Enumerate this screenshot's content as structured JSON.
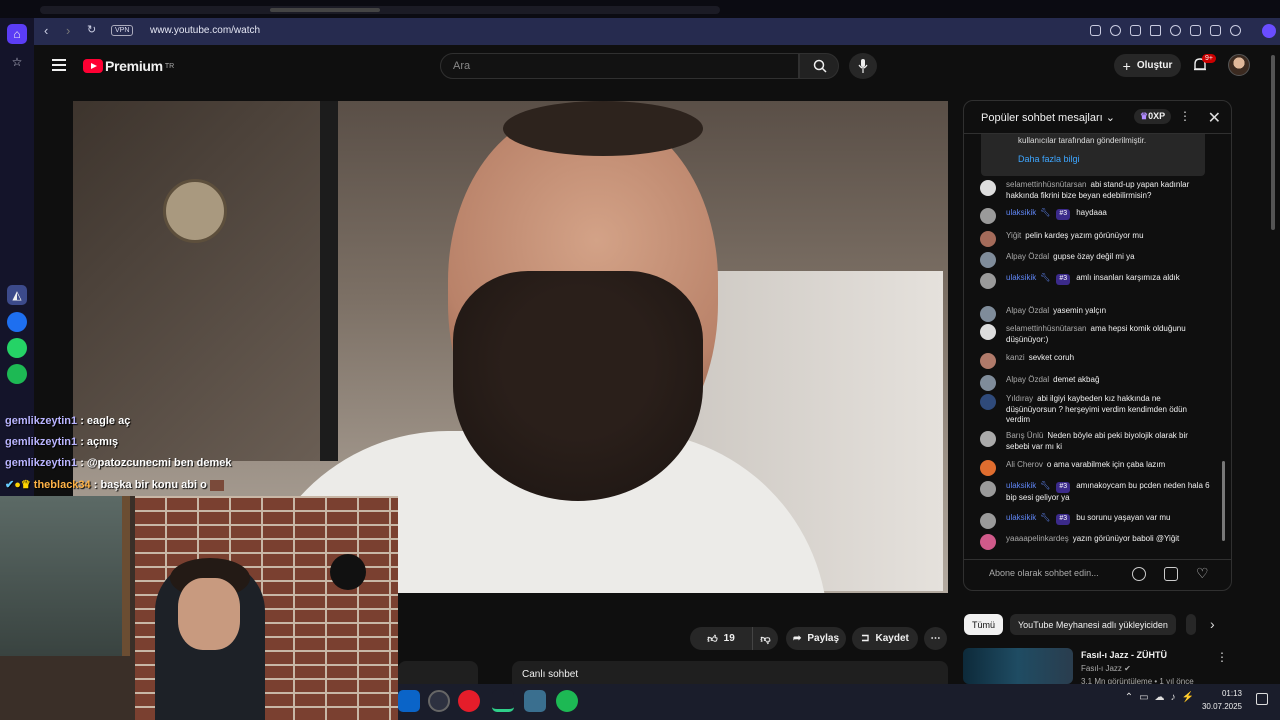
{
  "browser": {
    "vpn_label": "VPN",
    "url": "www.youtube.com/watch"
  },
  "header": {
    "logo_text": "Premium",
    "logo_region": "TR",
    "search_placeholder": "Ara",
    "create_label": "Oluştur",
    "notif_badge": "9+"
  },
  "video_actions": {
    "like_count": "19",
    "share_label": "Paylaş",
    "save_label": "Kaydet"
  },
  "below_video": {
    "live_chat_label": "Canlı sohbet"
  },
  "chat": {
    "title": "Popüler sohbet mesajları",
    "xp_label": "0XP",
    "notice_text": "kullanıcılar tarafından gönderilmiştir.",
    "notice_link": "Daha fazla bilgi",
    "messages": [
      {
        "author": "selamettinhüsnütarsan",
        "rank": "",
        "text": "abi stand-up yapan kadınlar hakkında fikrini bize beyan edebilirmisin?"
      },
      {
        "author": "ulaksikik",
        "rank": "#3",
        "text": "haydaaa"
      },
      {
        "author": "Yiğit",
        "rank": "",
        "text": "pelin kardeş yazım görünüyor mu"
      },
      {
        "author": "Alpay Özdal",
        "rank": "",
        "text": "gupse özay değil mi ya"
      },
      {
        "author": "ulaksikik",
        "rank": "#3",
        "text": "amlı insanları karşımıza aldık"
      },
      {
        "author": "Alpay Özdal",
        "rank": "",
        "text": "yasemin yalçın"
      },
      {
        "author": "selamettinhüsnütarsan",
        "rank": "",
        "text": "ama hepsi komik olduğunu düşünüyor:)"
      },
      {
        "author": "kanzi",
        "rank": "",
        "text": "sevket coruh"
      },
      {
        "author": "Alpay Özdal",
        "rank": "",
        "text": "demet akbağ"
      },
      {
        "author": "Yıldıray",
        "rank": "",
        "text": "abi ilgiyi kaybeden kız hakkında ne düşünüyorsun ? herşeyimi verdim kendimden ödün verdim"
      },
      {
        "author": "Barış Ünlü",
        "rank": "",
        "text": "Neden böyle abi peki biyolojik olarak bir sebebi var mı ki"
      },
      {
        "author": "Ali Cherov",
        "rank": "",
        "text": "o ama varabilmek için çaba lazım"
      },
      {
        "author": "ulaksikik",
        "rank": "#3",
        "text": "amınakoycam bu pcden neden hala 6 bip sesi geliyor ya"
      },
      {
        "author": "ulaksikik",
        "rank": "#3",
        "text": "bu sorunu yaşayan var mu"
      },
      {
        "author": "yaaaapelinkardeş",
        "rank": "",
        "text": "yazın görünüyor baboli @Yiğit"
      }
    ],
    "input_placeholder": "Abone olarak sohbet edin..."
  },
  "chips": [
    "Tümü",
    "YouTube Meyhanesi adlı yükleyiciden"
  ],
  "recommendation": {
    "title": "Fasıl-ı Jazz - ZÜHTÜ",
    "channel": "Fasıl-ı Jazz",
    "meta": "3,1 Mn görüntüleme • 1 yıl önce"
  },
  "overlay_chat": [
    {
      "user": "gemlikzeytin1",
      "text": ": eagle aç"
    },
    {
      "user": "gemlikzeytin1",
      "text": ": açmış"
    },
    {
      "user": "gemlikzeytin1",
      "text": ": @patozcunecmi ben demek"
    },
    {
      "user": "theblack34",
      "text": ": başka bir konu abi o"
    }
  ],
  "taskbar": {
    "time": "01:13",
    "date": "30.07.2025"
  },
  "colors": {
    "accent_red": "#ff0033",
    "link_blue": "#3ea6ff",
    "mod_blue": "#5e84f1"
  }
}
